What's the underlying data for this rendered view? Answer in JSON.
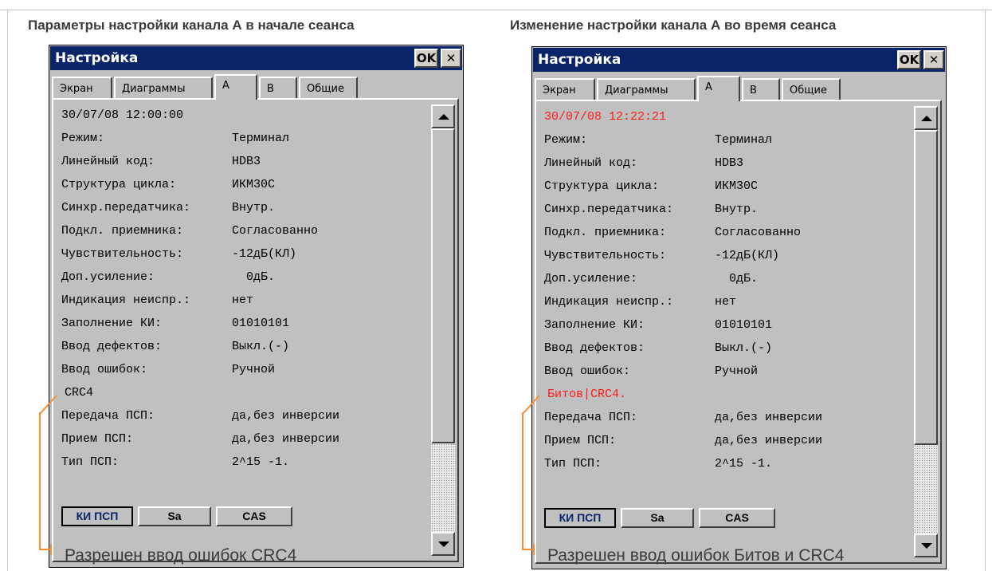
{
  "left": {
    "heading": "Параметры настройки канала А в начале сеанса",
    "caption": "Разрешен ввод ошибок CRC4",
    "window": {
      "title": "Настройка",
      "ok": "OK",
      "close": "✕",
      "tabs": [
        "Экран",
        "Диаграммы",
        "A",
        "B",
        "Общие"
      ],
      "timestamp": "30/07/08 12:00:00",
      "params": [
        {
          "label": "Режим:",
          "value": "Терминал"
        },
        {
          "label": "Линейный код:",
          "value": "HDB3"
        },
        {
          "label": "Структура цикла:",
          "value": "ИКМ30С"
        },
        {
          "label": "Синхр.передатчика:",
          "value": "Внутр."
        },
        {
          "label": "Подкл. приемника:",
          "value": "Согласованно"
        },
        {
          "label": "Чувствительность:",
          "value": "-12дБ(КЛ)"
        },
        {
          "label": "Доп.усиление:",
          "value": "  0дБ."
        },
        {
          "label": "Индикация неиспр.:",
          "value": "нет"
        },
        {
          "label": "Заполнение КИ:",
          "value": "01010101"
        },
        {
          "label": "Ввод дефектов:",
          "value": "Выкл.(-)"
        },
        {
          "label": "Ввод ошибок:",
          "value": "Ручной"
        }
      ],
      "error_mode": "CRC4",
      "params2": [
        {
          "label": "Передача ПСП:",
          "value": "да,без инверсии"
        },
        {
          "label": "Прием ПСП:",
          "value": "да,без инверсии"
        },
        {
          "label": "Тип ПСП:",
          "value": "2^15 -1."
        }
      ],
      "buttons": [
        "КИ ПСП",
        "Sa",
        "CAS"
      ]
    }
  },
  "right": {
    "heading": "Изменение настройки канала А во время сеанса",
    "caption": "Разрешен ввод ошибок Битов и CRC4",
    "window": {
      "title": "Настройка",
      "ok": "OK",
      "close": "✕",
      "tabs": [
        "Экран",
        "Диаграммы",
        "A",
        "B",
        "Общие"
      ],
      "timestamp": "30/07/08 12:22:21",
      "params": [
        {
          "label": "Режим:",
          "value": "Терминал"
        },
        {
          "label": "Линейный код:",
          "value": "HDB3"
        },
        {
          "label": "Структура цикла:",
          "value": "ИКМ30С"
        },
        {
          "label": "Синхр.передатчика:",
          "value": "Внутр."
        },
        {
          "label": "Подкл. приемника:",
          "value": "Согласованно"
        },
        {
          "label": "Чувствительность:",
          "value": "-12дБ(КЛ)"
        },
        {
          "label": "Доп.усиление:",
          "value": "  0дБ."
        },
        {
          "label": "Индикация неиспр.:",
          "value": "нет"
        },
        {
          "label": "Заполнение КИ:",
          "value": "01010101"
        },
        {
          "label": "Ввод дефектов:",
          "value": "Выкл.(-)"
        },
        {
          "label": "Ввод ошибок:",
          "value": "Ручной"
        }
      ],
      "error_mode": "Битов|CRC4.",
      "params2": [
        {
          "label": "Передача ПСП:",
          "value": "да,без инверсии"
        },
        {
          "label": "Прием ПСП:",
          "value": "да,без инверсии"
        },
        {
          "label": "Тип ПСП:",
          "value": "2^15 -1."
        }
      ],
      "buttons": [
        "КИ ПСП",
        "Sa",
        "CAS"
      ]
    }
  },
  "colors": {
    "titlebar": "#0a246a",
    "highlight": "#ff1a1a",
    "bracket": "#ff8a2a"
  }
}
